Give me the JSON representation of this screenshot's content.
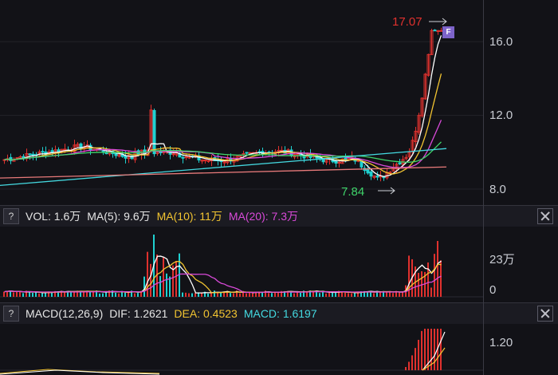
{
  "price_axis": {
    "ticks": [
      "16.0",
      "12.0",
      "8.0"
    ]
  },
  "annotations": {
    "high": "17.07",
    "low": "7.84",
    "badge": "F"
  },
  "volume_header": {
    "help": "?",
    "vol": "VOL: 1.6万",
    "ma5": "MA(5): 9.6万",
    "ma10": "MA(10): 11万",
    "ma20": "MA(20): 7.3万"
  },
  "volume_axis": {
    "ticks": [
      "23万",
      "0"
    ]
  },
  "macd_header": {
    "help": "?",
    "name": "MACD(12,26,9)",
    "dif": "DIF: 1.2621",
    "dea": "DEA: 0.4523",
    "macd": "MACD: 1.6197"
  },
  "macd_axis": {
    "ticks": [
      "1.20"
    ]
  },
  "colors": {
    "up": "#e0312e",
    "down": "#1fd1d1",
    "ma5": "#ffffff",
    "ma10": "#f2c431",
    "ma20": "#d94ad9",
    "ma60": "#3fd46a",
    "ma120": "#44d9e0",
    "ma250": "#e87a7a"
  }
}
